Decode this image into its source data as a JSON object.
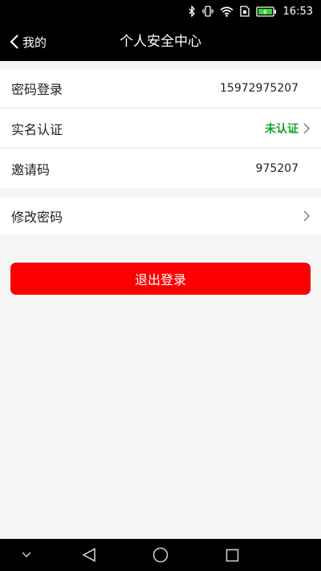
{
  "status_bar": {
    "time": "16:53",
    "icons": [
      "bluetooth-icon",
      "vibrate-icon",
      "wifi-icon",
      "sim-icon",
      "battery-icon"
    ]
  },
  "header": {
    "back_label": "我的",
    "title": "个人安全中心"
  },
  "group1": [
    {
      "label": "密码登录",
      "value": "15972975207"
    },
    {
      "label": "实名认证",
      "value": "未认证",
      "value_color": "#18a325"
    },
    {
      "label": "邀请码",
      "value": "975207"
    }
  ],
  "group2": [
    {
      "label": "修改密码"
    }
  ],
  "logout_label": "退出登录",
  "colors": {
    "header_bg": "#000000",
    "logout_button": "#fb0000",
    "verify_status": "#18a325",
    "page_bg": "#f5f5f5"
  },
  "system_nav": [
    "chevron-down-icon",
    "back-triangle-icon",
    "home-circle-icon",
    "recents-square-icon"
  ]
}
